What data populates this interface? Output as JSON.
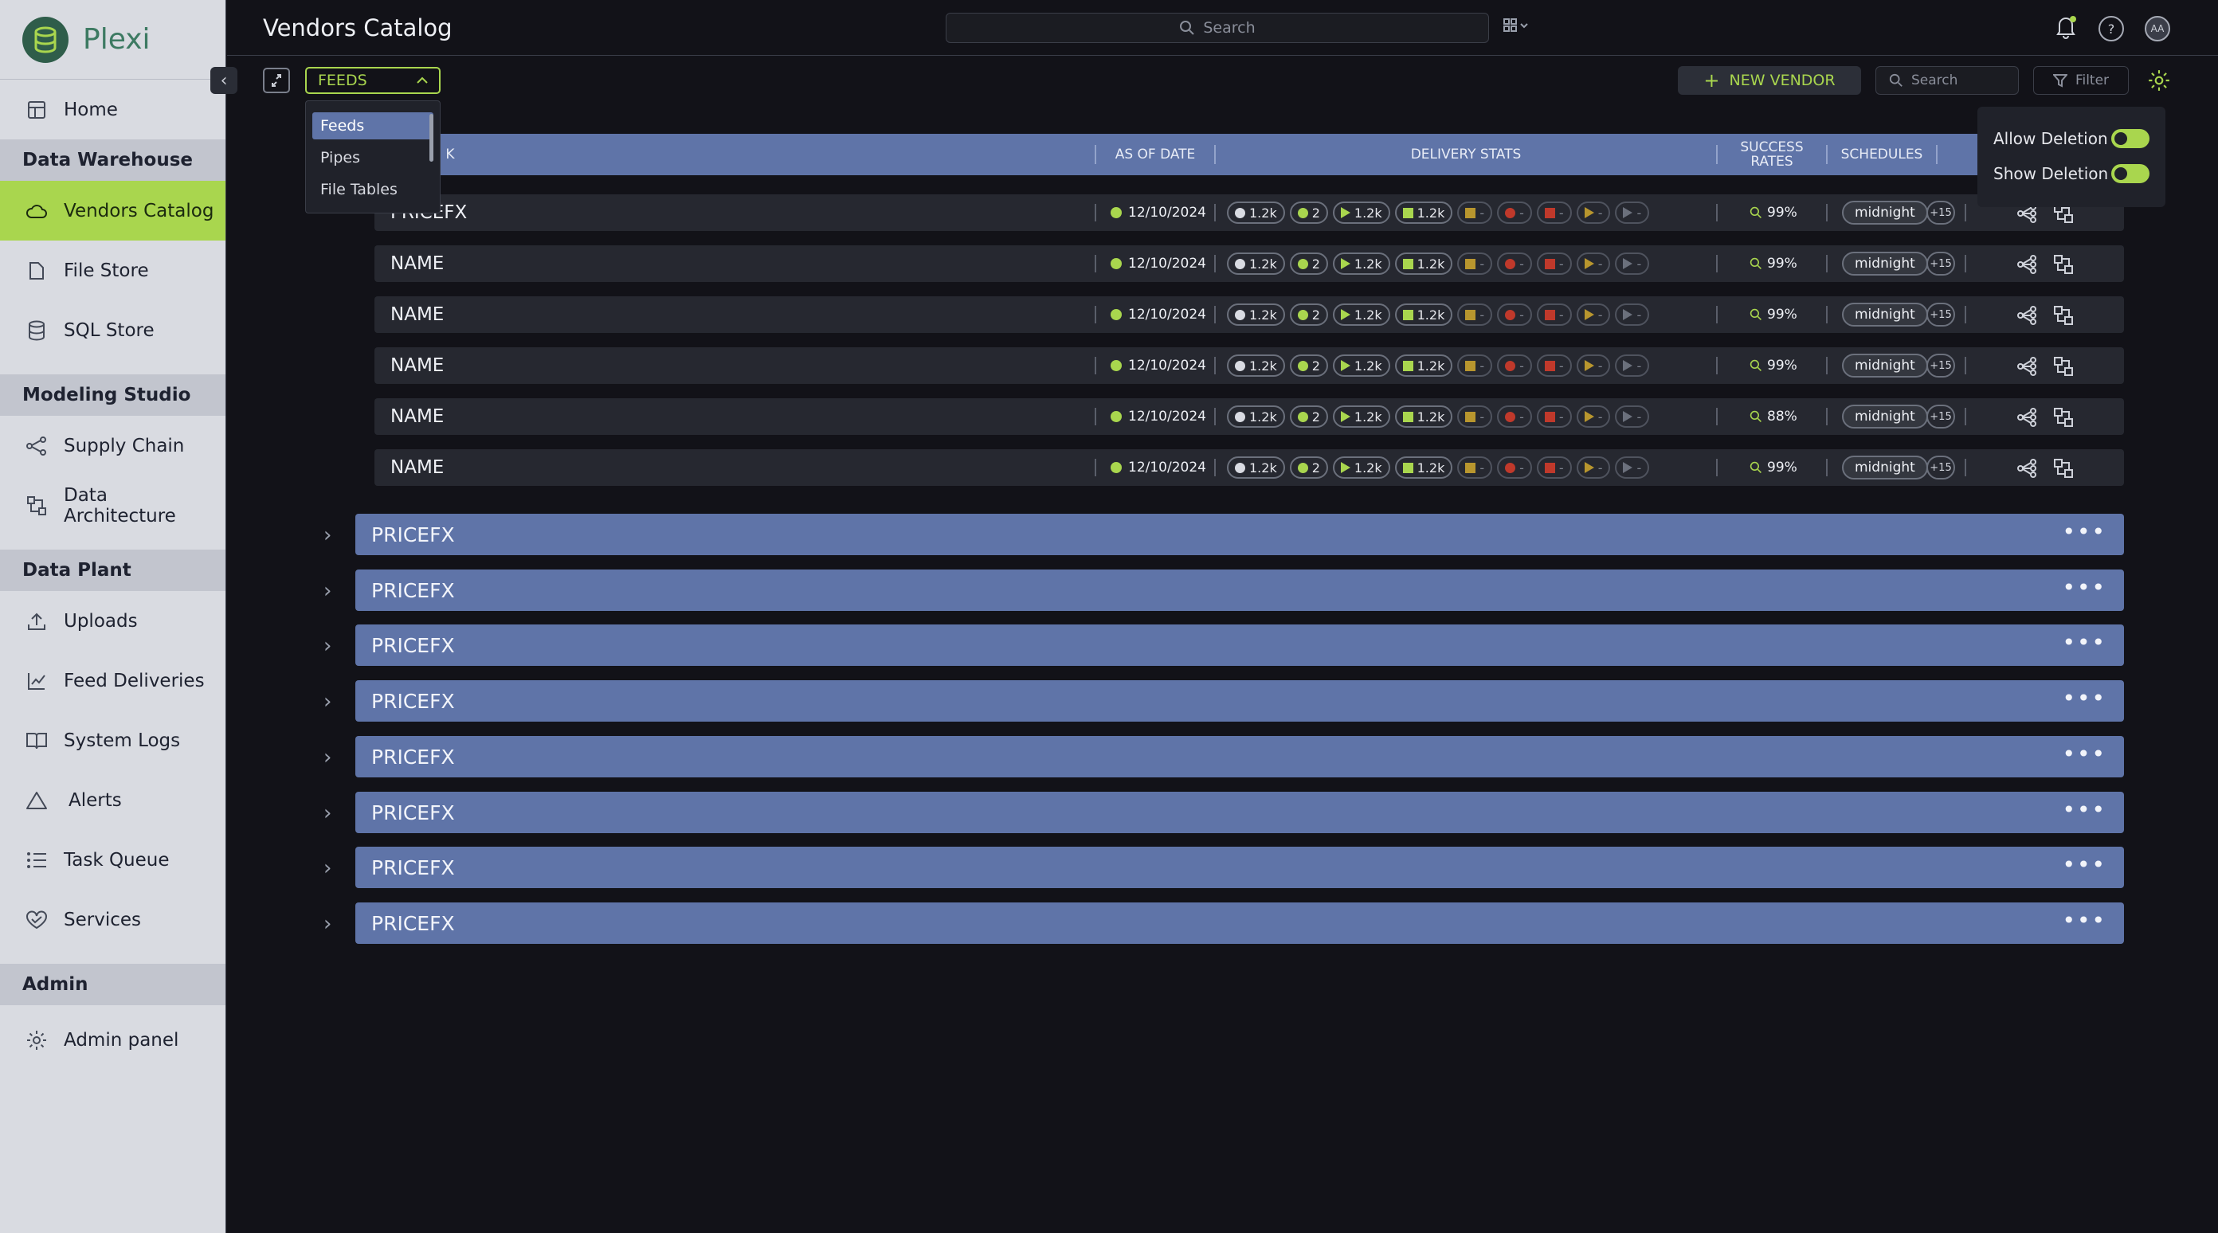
{
  "app": {
    "name": "Plexi"
  },
  "sidebar": {
    "home": "Home",
    "sections": [
      {
        "title": "Data Warehouse",
        "items": [
          "Vendors Catalog",
          "File Store",
          "SQL Store"
        ]
      },
      {
        "title": "Modeling Studio",
        "items": [
          "Supply Chain",
          "Data Architecture"
        ]
      },
      {
        "title": "Data Plant",
        "items": [
          "Uploads",
          "Feed Deliveries",
          "System Logs",
          "Alerts",
          "Task Queue",
          "Services"
        ]
      },
      {
        "title": "Admin",
        "items": [
          "Admin panel"
        ]
      }
    ],
    "active": "Vendors Catalog"
  },
  "header": {
    "title": "Vendors Catalog",
    "search_placeholder": "Search",
    "avatar_initials": "AA"
  },
  "toolbar": {
    "view_select": "FEEDS",
    "view_options": [
      "Feeds",
      "Pipes",
      "File Tables"
    ],
    "new_vendor": "NEW VENDOR",
    "search_placeholder": "Search",
    "filter": "Filter"
  },
  "settings_popover": {
    "allow_deletion": "Allow Deletion",
    "show_deletion": "Show Deletion",
    "allow_deletion_on": true,
    "show_deletion_on": true
  },
  "table": {
    "columns": {
      "name_partial": "K",
      "as_of_date": "AS OF DATE",
      "delivery_stats": "DELIVERY STATS",
      "success_rates_1": "SUCCESS",
      "success_rates_2": "RATES",
      "schedules": "SCHEDULES"
    },
    "rows": [
      {
        "name": "PRICEFX",
        "date": "12/10/2024",
        "rate": "99%",
        "schedule": "midnight",
        "more": "+15"
      },
      {
        "name": "NAME",
        "date": "12/10/2024",
        "rate": "99%",
        "schedule": "midnight",
        "more": "+15"
      },
      {
        "name": "NAME",
        "date": "12/10/2024",
        "rate": "99%",
        "schedule": "midnight",
        "more": "+15"
      },
      {
        "name": "NAME",
        "date": "12/10/2024",
        "rate": "99%",
        "schedule": "midnight",
        "more": "+15"
      },
      {
        "name": "NAME",
        "date": "12/10/2024",
        "rate": "88%",
        "schedule": "midnight",
        "more": "+15"
      },
      {
        "name": "NAME",
        "date": "12/10/2024",
        "rate": "99%",
        "schedule": "midnight",
        "more": "+15"
      }
    ],
    "stats": {
      "a": "1.2k",
      "b": "2",
      "c": "1.2k",
      "d": "1.2k",
      "dash": "-"
    }
  },
  "vendors": [
    "PRICEFX",
    "PRICEFX",
    "PRICEFX",
    "PRICEFX",
    "PRICEFX",
    "PRICEFX",
    "PRICEFX",
    "PRICEFX"
  ],
  "colors": {
    "accent": "#a9d64e",
    "header_blue": "#5f74a8",
    "yellow": "#b8962e",
    "red": "#c0392b",
    "grey": "#6b707c"
  }
}
